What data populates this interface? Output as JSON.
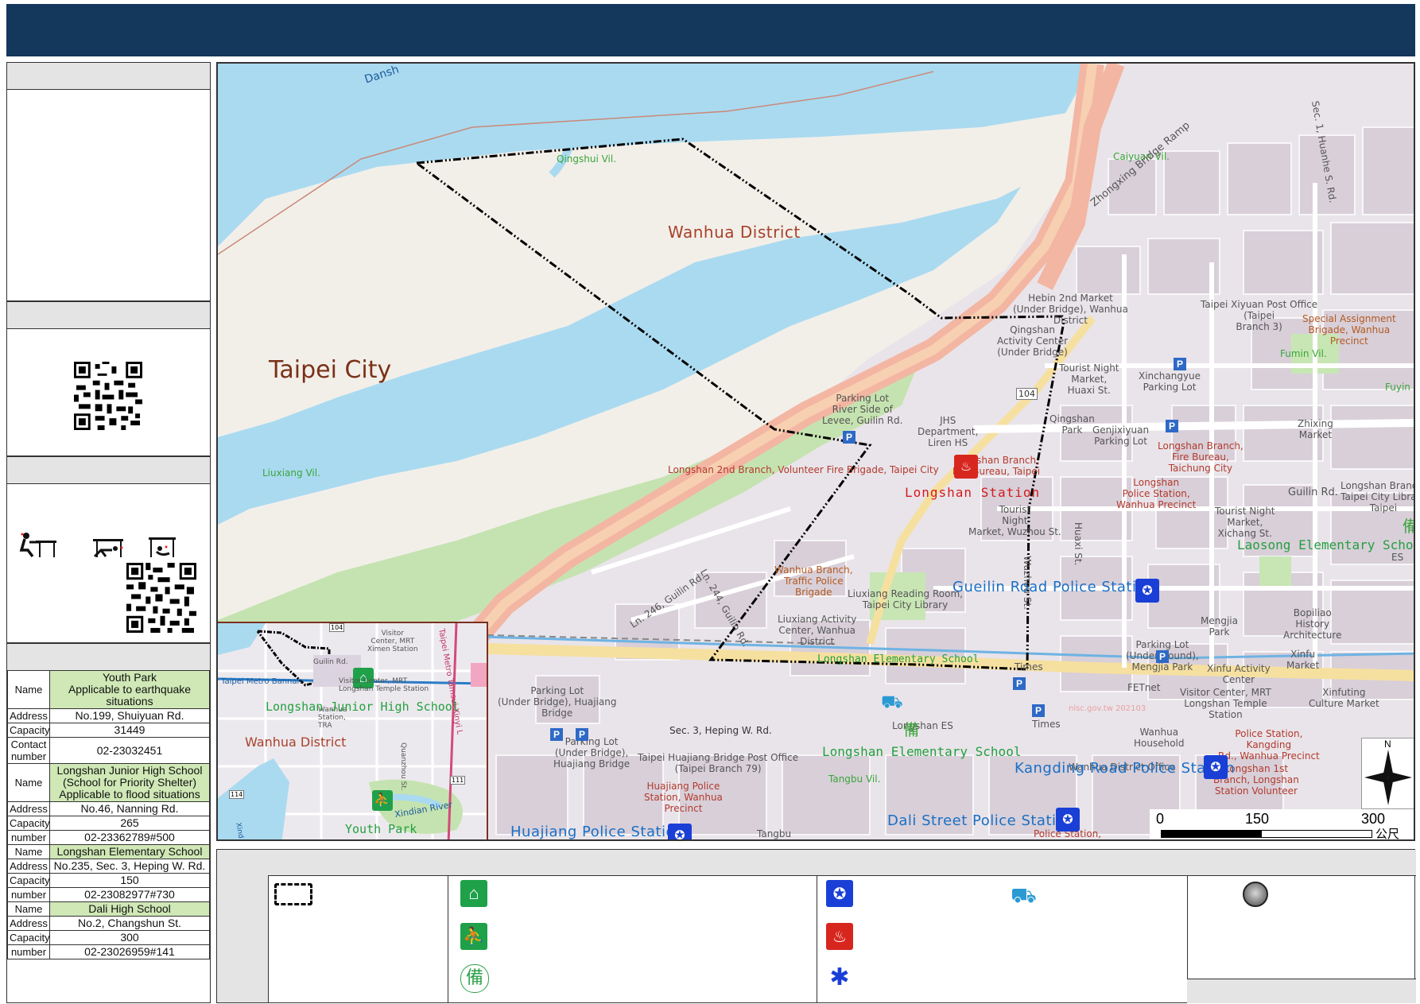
{
  "colors": {
    "header": "#14375c",
    "river": "#aadaf0",
    "riverbank": "#f2efe9",
    "park": "#c5e3b0",
    "boundary": "#000000",
    "police": "#1a3fd6",
    "fire": "#d7261e",
    "shelter": "#1fa14a"
  },
  "shelters": [
    {
      "name": "Youth Park\nApplicable to earthquake situations",
      "address": "No.199, Shuiyuan Rd.",
      "capacity": "31449",
      "contact": "02-23032451",
      "contact_label": "Contact number"
    },
    {
      "name": "Longshan Junior High School\n(School for Priority Shelter)\nApplicable to flood situations",
      "address": "No.46, Nanning Rd.",
      "capacity": "265",
      "contact": "02-23362789#500",
      "contact_label": "number"
    },
    {
      "name": "Longshan Elementary School",
      "address": "No.235, Sec. 3, Heping W. Rd.",
      "capacity": "150",
      "contact": "02-23082977#730",
      "contact_label": "number"
    },
    {
      "name": "Dali High School",
      "address": "No.2, Changshun St.",
      "capacity": "300",
      "contact": "02-23026959#141",
      "contact_label": "number"
    }
  ],
  "labels": {
    "name": "Name",
    "address": "Address",
    "capacity": "Capacity"
  },
  "map": {
    "district": "Wanhua District",
    "city": "Taipei City",
    "villages": [
      "Qingshui Vil.",
      "Caiyuan Vil.",
      "Liuxiang Vil.",
      "Fumin Vil.",
      "Fuyin Vil.",
      "Tangbu Vil."
    ],
    "stations": {
      "longshan_station": "Longshan Station",
      "gueilin_police": "Gueilin Road Police Station",
      "kangding_police": "Kangding Road Police Station",
      "dali_police": "Dali Street Police Station",
      "huajiang_police": "Huajiang Police Station",
      "laosong_es": "Laosong Elementary School",
      "longshan_es_1": "Longshan Elementary School",
      "longshan_es_2": "Longshan Elementary School"
    },
    "roads": {
      "zhongxing": "Zhongxing Bridge Ramp",
      "huanhe": "Sec. 1, Huanhe S. Rd.",
      "guilin": "Guilin Rd.",
      "heping": "Sec. 3, Heping W. Rd.",
      "ln246": "Ln. 246, Guilin Rd.",
      "ln244": "Ln. 244, Guilin Rd.",
      "huaxi": "Huaxi St.",
      "wuzhou": "Wuzhou St.",
      "danshui": "Dansh",
      "route104": "104"
    },
    "pois": {
      "hebin": "Hebin 2nd Market\n(Under Bridge), Wanhua\nDistrict",
      "qingshan_ac": "Qingshan\nActivity Center\n(Under Bridge)",
      "tourist_night_huaxi": "Tourist Night\nMarket,\nHuaxi St.",
      "xinchangyue": "Xinchangyue\nParking Lot",
      "qingshan_park": "Qingshan\nPark",
      "genjixiyuan": "Genjixiyuan\nParking Lot",
      "xiyuan_post": "Taipei Xiyuan Post Office\n(Taipei\nBranch 3)",
      "special_brigade": "Special Assignment\nBrigade, Wanhua\nPrecinct",
      "zhixing": "Zhixing\nMarket",
      "parking_river": "Parking Lot\nRiver Side of\nLevee, Guilin Rd.",
      "jhs_dept": "JHS\nDepartment,\nLiren HS",
      "longshan_fire": "Longshan Branch,\nFire Bureau, Taipei",
      "longshan_2nd": "Longshan 2nd Branch, Volunteer Fire Brigade, Taipei City",
      "tourist_wuzhou": "Tourist\nNight\nMarket, Wuzhou St.",
      "longshan_branch_fire": "Longshan Branch,\nFire Bureau,\nTaichung City",
      "longshan_police": "Longshan\nPolice Station,\nWanhua Precinct",
      "tourist_xichang": "Tourist Night\nMarket,\nXichang St.",
      "longshan_branch_lib": "Longshan Branch,\nTaipei City Library\nTaipei",
      "laosong_es_small": "ES",
      "wanhua_traffic": "Wanhua Branch,\nTraffic Police\nBrigade",
      "liuxiang_reading": "Liuxiang Reading Room,\nTaipei City Library",
      "liuxiang_ac": "Liuxiang Activity\nCenter, Wanhua\nDistrict",
      "mengjia_park": "Mengjia\nPark",
      "parking_mengjia": "Parking Lot\n(Underground),\nMengjia Park",
      "bopiliao": "Bopiliao\nHistory\nArchitecture",
      "xinfu_market": "Xinfu\nMarket",
      "xinfu_ac": "Xinfu Activity\nCenter",
      "visitor_center": "Visitor Center, MRT\nLongshan Temple\nStation",
      "xinfuting": "Xinfuting\nCulture Market",
      "times1": "Times",
      "times2": "Times",
      "fetnet": "FETnet",
      "longshan_es_small": "Longshan ES",
      "parking_huajiang1": "Parking Lot\n(Under Bridge), Huajiang\nBridge",
      "parking_huajiang2": "Parking Lot\n(Under Bridge),\nHuajiang Bridge",
      "huajiang_post": "Taipei Huajiang Bridge Post Office\n(Taipei Branch 79)",
      "huajiang_police_small": "Huajiang Police\nStation, Wanhua\nPrecinct",
      "household": "Wanhua\nHousehold",
      "wanhua_office": "Wanhua District Office",
      "police_station_right": "Police Station,\nKangding\nRd., Wanhua Precinct",
      "longshan_1st": "Longshan 1st\nBranch, Longshan\nStation Volunteer",
      "tangbu_small": "Tangbu",
      "police_small2": "Police Station,"
    },
    "inset": {
      "district": "Wanhua District",
      "jhs": "Longshan Junior High School",
      "park": "Youth Park",
      "metro": "Taipei Metro Tamsui-Xinyi L",
      "bannan": "Taipei Metro Bannan",
      "ximen": "Visitor\nCenter, MRT\nXimen Station",
      "wanhua_tra": "Wanhua\nStation,\nTRA",
      "longshan_temple": "Visitor Center, MRT\nLongshan Temple Station",
      "xindian": "Xindian River",
      "quanzhou": "Quanzhou St.",
      "guilin_small": "Guilin Rd.",
      "r104": "104",
      "r111": "111",
      "r114": "114",
      "xind": "Xind"
    },
    "scale": {
      "s0": "0",
      "s150": "150",
      "s300": "300",
      "unit": "公尺"
    },
    "compass_n": "N",
    "watermark": "nlsc.gov.tw 202103"
  },
  "legend": {
    "standby_glyph": "備",
    "shelter_glyph": "⌂",
    "park_glyph": "⛹"
  }
}
